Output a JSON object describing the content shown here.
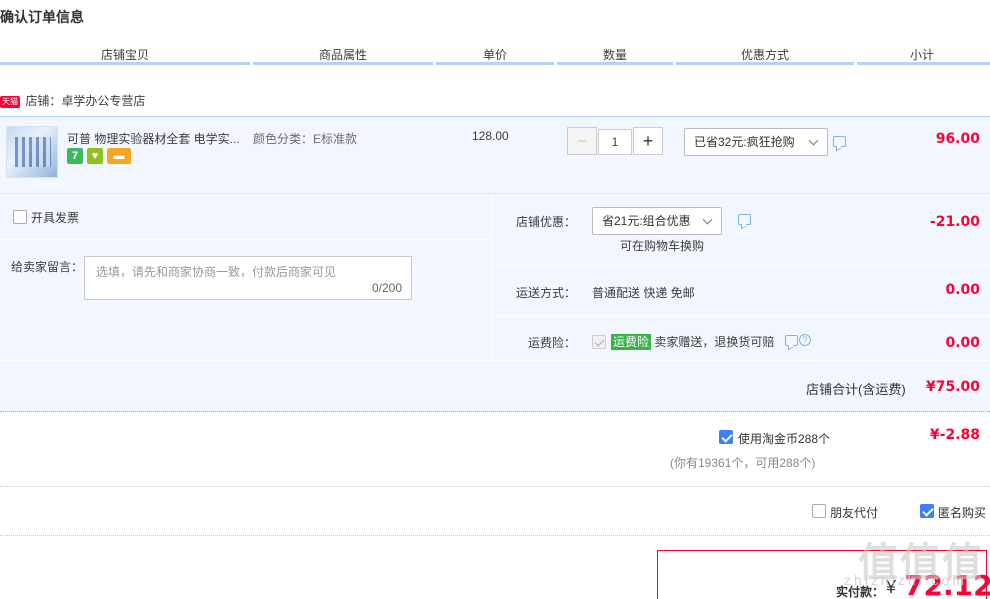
{
  "page_title": "确认订单信息",
  "columns": [
    "店铺宝贝",
    "商品属性",
    "单价",
    "数量",
    "优惠方式",
    "小计"
  ],
  "shop": {
    "badge": "天猫",
    "name": "店铺：卓学办公专营店"
  },
  "item": {
    "title": "可普 物理实验器材全套 电学实...",
    "attribute": "颜色分类：E标准款",
    "unit_price": "128.00",
    "quantity": "1",
    "discount_select": "已省32元:疯狂抢购",
    "subtotal": "96.00",
    "badges": [
      {
        "text": "7",
        "color": "#3db85a"
      },
      {
        "text": "♥",
        "color": "#8ec21f"
      },
      {
        "text": "▬",
        "color": "#f5a623"
      }
    ]
  },
  "invoice": {
    "label": "开具发票"
  },
  "message": {
    "label": "给卖家留言：",
    "placeholder": "选填，请先和商家协商一致，付款后商家可见",
    "counter": "0/200"
  },
  "shop_discount": {
    "label": "店铺优惠：",
    "select": "省21元:组合优惠",
    "note": "可在购物车换购",
    "amount": "-21.00"
  },
  "shipping": {
    "label": "运送方式：",
    "value": "普通配送 快递 免邮",
    "amount": "0.00"
  },
  "insurance": {
    "label": "运费险：",
    "tag": "运费险",
    "desc": "卖家赠送，退换货可赔",
    "amount": "0.00"
  },
  "shop_total": {
    "label": "店铺合计(含运费)",
    "amount": "¥75.00"
  },
  "taobao_coin": {
    "label": "使用淘金币288个",
    "note": "(你有19361个，可用288个)",
    "amount": "¥-2.88"
  },
  "options": {
    "friend_pay": "朋友代付",
    "anonymous": "匿名购买"
  },
  "payment": {
    "label": "实付款：",
    "currency": "¥",
    "amount": "72.12"
  },
  "watermark": {
    "logo": "值值值",
    "domain": "zhizhizhi.com"
  }
}
